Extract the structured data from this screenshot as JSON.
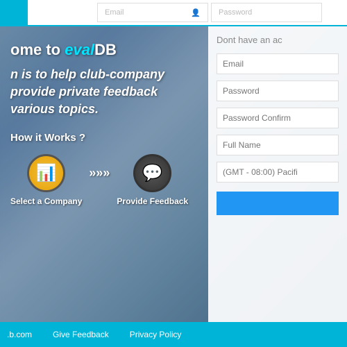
{
  "topnav": {
    "email_placeholder": "Email",
    "password_placeholder": "Password"
  },
  "hero": {
    "welcome_prefix": "ome to ",
    "brand_eval": "eval",
    "brand_db": "DB",
    "sub1": "n is to help club-company",
    "sub2": "provide private feedback",
    "sub3": "various topics.",
    "how_it_works": "How it Works ?",
    "step1_label": "Select a Company",
    "step2_label": "Provide Feedback",
    "arrow": "»»»"
  },
  "signup": {
    "title": "Dont have an ac",
    "email_placeholder": "Email",
    "password_placeholder": "Password",
    "password_confirm_placeholder": "Password Confirm",
    "fullname_placeholder": "Full Name",
    "timezone_placeholder": "(GMT - 08:00) Pacifi",
    "btn_label": ""
  },
  "footer": {
    "item1": ".b.com",
    "item2": "Give Feedback",
    "item3": "Privacy Policy"
  },
  "colors": {
    "accent": "#00b4d8",
    "btn_blue": "#2196f3"
  }
}
